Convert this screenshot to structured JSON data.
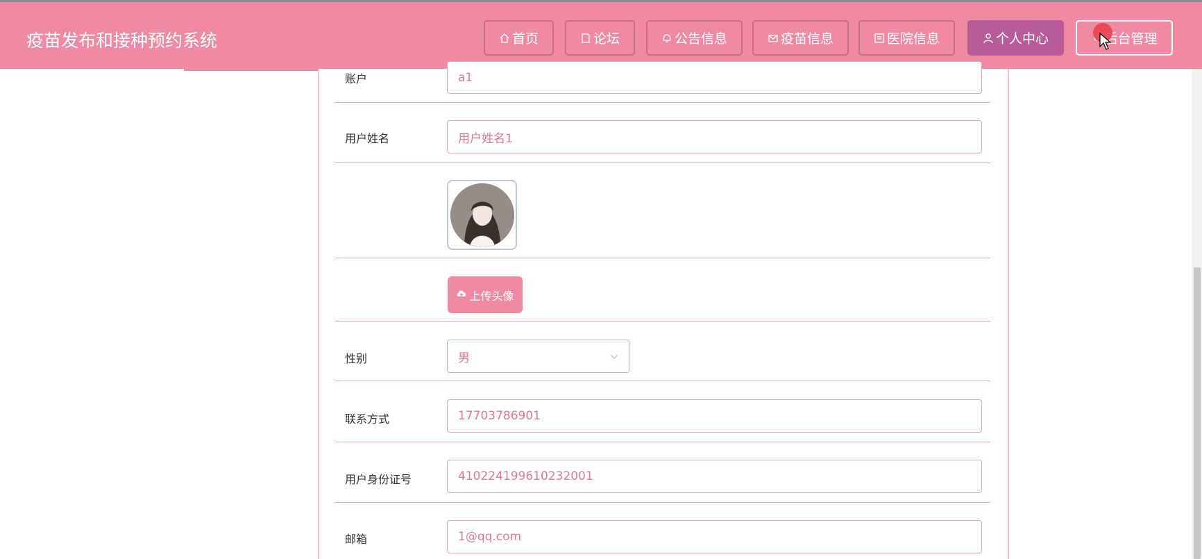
{
  "header": {
    "brand": "疫苗发布和接种预约系统",
    "nav": [
      {
        "label": "首页",
        "icon": "home-icon"
      },
      {
        "label": "论坛",
        "icon": "document-icon"
      },
      {
        "label": "公告信息",
        "icon": "bell-icon"
      },
      {
        "label": "疫苗信息",
        "icon": "mail-icon"
      },
      {
        "label": "医院信息",
        "icon": "list-icon"
      },
      {
        "label": "个人中心",
        "icon": "user-icon"
      },
      {
        "label": "后台管理",
        "icon": "gear-icon"
      }
    ]
  },
  "form": {
    "account_label": "账户",
    "account_value": "a1",
    "username_label": "用户姓名",
    "username_value": "用户姓名1",
    "upload_label": "上传头像",
    "gender_label": "性别",
    "gender_value": "男",
    "phone_label": "联系方式",
    "phone_value": "17703786901",
    "idcard_label": "用户身份证号",
    "idcard_value": "410224199610232001",
    "email_label": "邮箱",
    "email_value": "1@qq.com"
  },
  "colors": {
    "header_bg": "#f08aa2",
    "active_nav": "#b85c99",
    "field_border": "#eca3b5",
    "field_text": "#e07a95"
  }
}
